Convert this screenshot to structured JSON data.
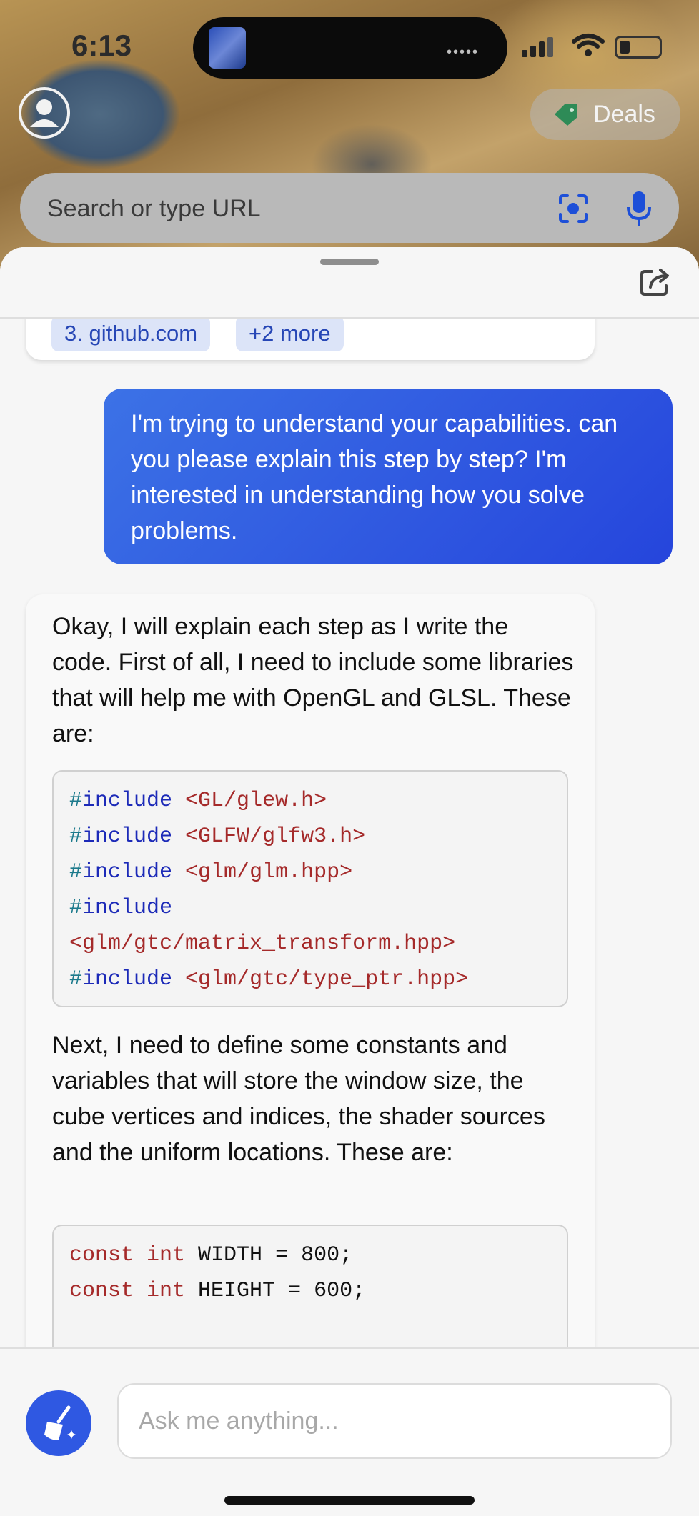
{
  "status_bar": {
    "time": "6:13"
  },
  "top": {
    "deals_label": "Deals",
    "search_placeholder": "Search or type URL"
  },
  "sources": {
    "chips": [
      "3. github.com",
      "+2 more"
    ]
  },
  "conversation": {
    "user_message": "I'm trying to understand your capabilities. can you please explain this step by step? I'm interested in understanding how you solve problems.",
    "bot_intro": "Okay, I will explain each step as I write the code. First of all, I need to include some libraries that will help me with OpenGL and GLSL. These are:",
    "includes": [
      {
        "hash": "#",
        "kw": "include",
        "path": " <GL/glew.h>"
      },
      {
        "hash": "#",
        "kw": "include",
        "path": " <GLFW/glfw3.h>"
      },
      {
        "hash": "#",
        "kw": "include",
        "path": " <glm/glm.hpp>"
      },
      {
        "hash": "#",
        "kw": "include",
        "path": ""
      },
      {
        "hash": "",
        "kw": "",
        "path": "<glm/gtc/matrix_transform.hpp>"
      },
      {
        "hash": "#",
        "kw": "include",
        "path": " <glm/gtc/type_ptr.hpp>"
      }
    ],
    "bot_next": "Next, I need to define some constants and variables that will store the window size, the cube vertices and indices, the shader sources and the uniform locations. These are:",
    "constants": [
      {
        "kw1": "const",
        "kw2": "int",
        "rest": " WIDTH = 800;"
      },
      {
        "kw1": "const",
        "kw2": "int",
        "rest": " HEIGHT = 600;"
      }
    ]
  },
  "composer": {
    "placeholder": "Ask me anything..."
  },
  "colors": {
    "accent": "#2f58e2",
    "user_bubble": "#2f57e0"
  }
}
